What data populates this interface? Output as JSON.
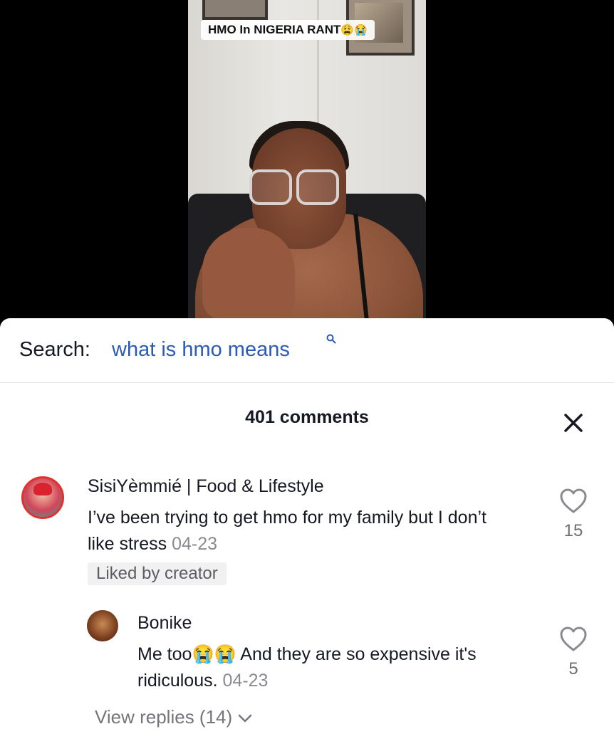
{
  "video": {
    "caption": "HMO In NIGERIA RANT",
    "caption_emojis": "😩😭"
  },
  "search": {
    "label": "Search:",
    "query": "what is hmo means",
    "icon": "search-icon"
  },
  "comments": {
    "count_label": "401 comments",
    "close_icon": "close-icon",
    "items": [
      {
        "username": "SisiYèmmié | Food & Lifestyle",
        "text": "I’ve been trying to get hmo for my family but I don’t like stress",
        "date": "04-23",
        "badge": "Liked by creator",
        "likes": "15"
      }
    ],
    "replies": [
      {
        "username": "Bonike",
        "text_before": "Me too",
        "emojis": "😭😭",
        "text_after": "And they are so expensive it's ridiculous.",
        "date": "04-23",
        "likes": "5"
      }
    ],
    "view_replies": "View replies (14)"
  },
  "colors": {
    "search_query": "#2b5bb5",
    "text_primary": "#161823",
    "text_secondary": "#8a8b91"
  }
}
